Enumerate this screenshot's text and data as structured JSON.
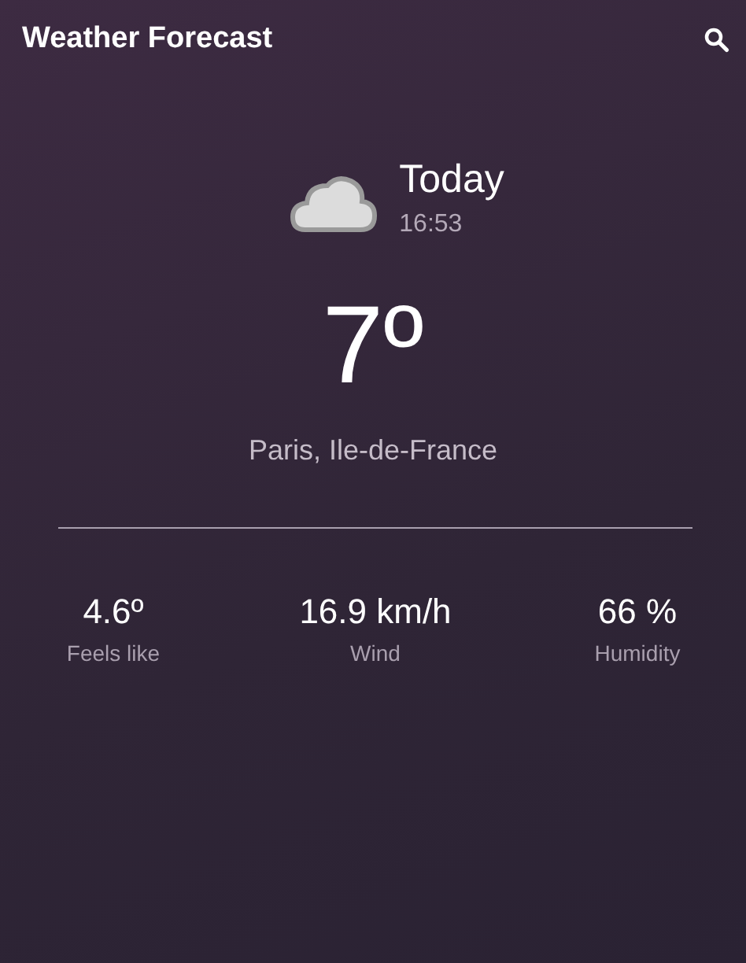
{
  "app_bar": {
    "title": "Weather Forecast"
  },
  "current": {
    "day": "Today",
    "time": "16:53",
    "temperature": "7º",
    "location": "Paris, Ile-de-France"
  },
  "details": [
    {
      "value": "4.6º",
      "label": "Feels like"
    },
    {
      "value": "16.9 km/h",
      "label": "Wind"
    },
    {
      "value": "66 %",
      "label": "Humidity"
    }
  ]
}
